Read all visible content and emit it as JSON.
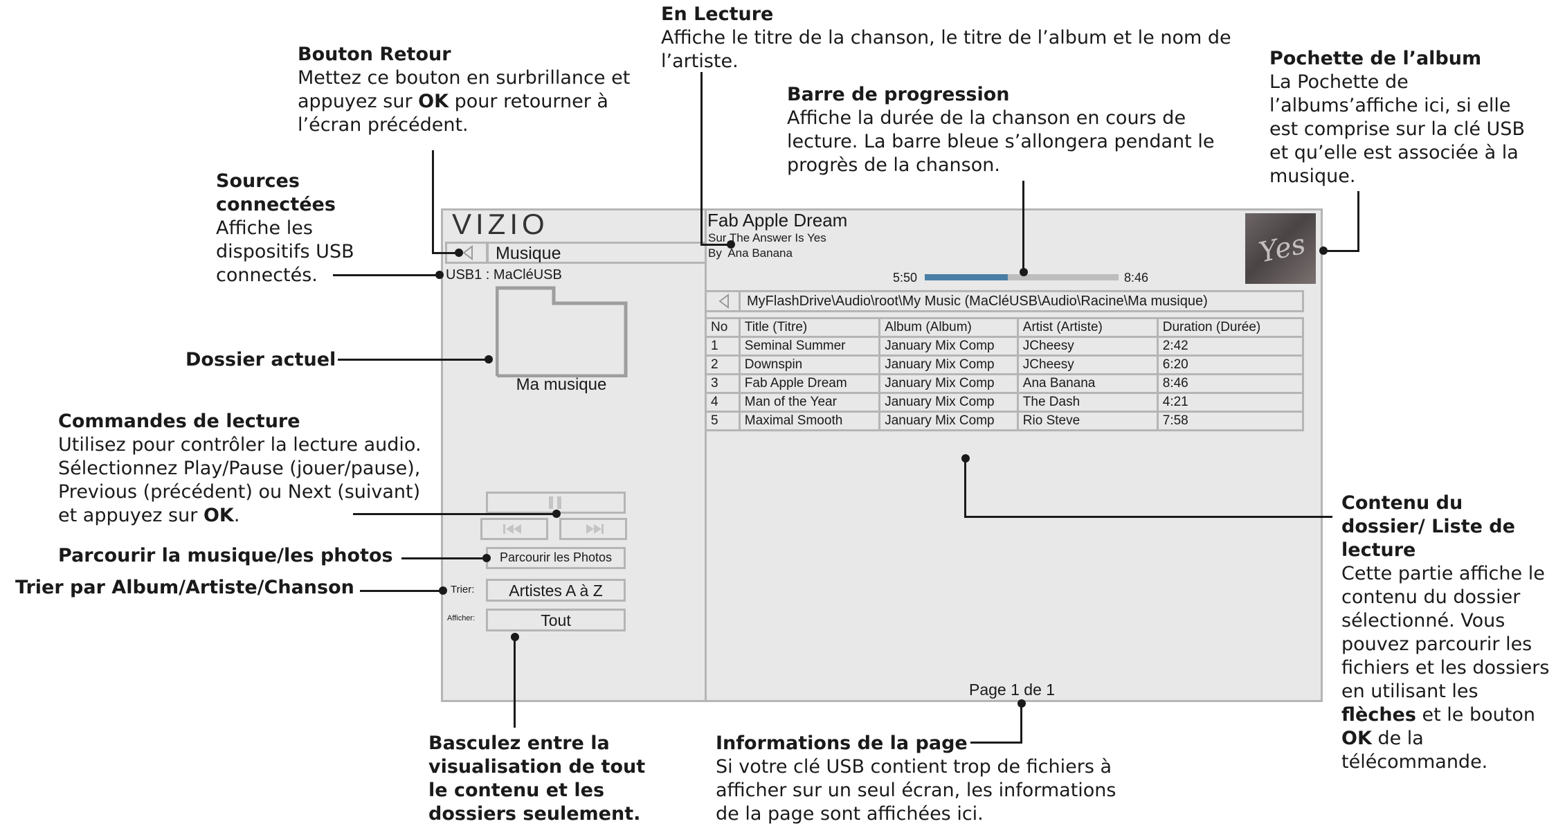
{
  "screen": {
    "logo": "VIZIO",
    "back_label": "Musique",
    "source_label": "USB1 : MaCléUSB",
    "current_folder": "Ma musique",
    "browse_photos_label": "Parcourir les Photos",
    "sort_label": "Trier:",
    "sort_value": "Artistes A à Z",
    "view_label": "Afficher:",
    "view_value": "Tout",
    "now_playing": {
      "title": "Fab Apple Dream",
      "album_line": "Sur The Answer Is Yes",
      "artist_line": "By  Ana Banana",
      "elapsed": "5:50",
      "total": "8:46",
      "progress": 0.43,
      "album_art_text": "Yes"
    },
    "path": "MyFlashDrive\\Audio\\root\\My Music (MaCléUSB\\Audio\\Racine\\Ma musique)",
    "table": {
      "headers": [
        "No",
        "Title (Titre)",
        "Album (Album)",
        "Artist (Artiste)",
        "Duration (Durée)"
      ],
      "rows": [
        [
          "1",
          "Seminal Summer",
          "January Mix Comp",
          "JCheesy",
          "2:42"
        ],
        [
          "2",
          "Downspin",
          "January Mix Comp",
          "JCheesy",
          "6:20"
        ],
        [
          "3",
          "Fab Apple Dream",
          "January Mix Comp",
          "Ana Banana",
          "8:46"
        ],
        [
          "4",
          "Man of the Year",
          "January Mix Comp",
          "The Dash",
          "4:21"
        ],
        [
          "5",
          "Maximal Smooth",
          "January Mix Comp",
          "Rio Steve",
          "7:58"
        ]
      ]
    },
    "page_info": "Page 1 de 1",
    "colors": {
      "progress_fill": "#4a7fa5",
      "progress_track": "#bdbdbd",
      "panel_bg": "#e8e8e8",
      "border": "#b5b5b5"
    },
    "icons": {
      "back": "triangle-left-icon",
      "pause": "pause-icon",
      "previous": "previous-track-icon",
      "next": "next-track-icon",
      "folder": "folder-icon"
    }
  },
  "callouts": {
    "en_lecture": {
      "title": "En Lecture",
      "body": "Affiche le titre de la chanson, le titre de l’album et le nom de l’artiste."
    },
    "bouton_retour": {
      "title": "Bouton Retour",
      "body_1": "Mettez ce bouton en surbrillance et appuyez sur ",
      "body_bold": "OK",
      "body_2": " pour retourner à l’écran précédent."
    },
    "barre_progression": {
      "title": "Barre de progression",
      "body": "Affiche la durée de la chanson en cours de lecture. La barre bleue s’allongera pendant le progrès de la chanson."
    },
    "pochette": {
      "title": "Pochette de l’album",
      "body": "La Pochette de l’albums’affiche ici, si elle est comprise sur la clé USB et qu’elle est associée à la musique."
    },
    "sources": {
      "title": "Sources connectées",
      "body": "Affiche les dispositifs USB connectés."
    },
    "dossier_actuel": {
      "title": "Dossier actuel"
    },
    "commandes": {
      "title": "Commandes de lecture",
      "body_1": "Utilisez pour contrôler la lecture audio. Sélectionnez Play/Pause (jouer/pause), Previous (précédent) ou Next (suivant) et appuyez sur ",
      "body_bold": "OK",
      "body_2": "."
    },
    "parcourir": {
      "title": "Parcourir la musique/les photos"
    },
    "trier": {
      "title": "Trier par Album/Artiste/Chanson"
    },
    "contenu": {
      "title": "Contenu du dossier/ Liste de lecture",
      "body_1": "Cette partie affiche le contenu du dossier sélectionné. Vous pouvez parcourir les fichiers et les dossiers en utilisant les ",
      "body_bold_1": "flèches",
      "body_2": " et le bouton ",
      "body_bold_2": "OK",
      "body_3": " de la télécommande."
    },
    "basculez": {
      "title": "Basculez entre la visualisation de tout le contenu et les dossiers seulement."
    },
    "informations": {
      "title": "Informations de la page",
      "body": "Si votre clé USB contient trop de fichiers à afficher sur un seul écran, les informations de la page sont affichées ici."
    }
  }
}
